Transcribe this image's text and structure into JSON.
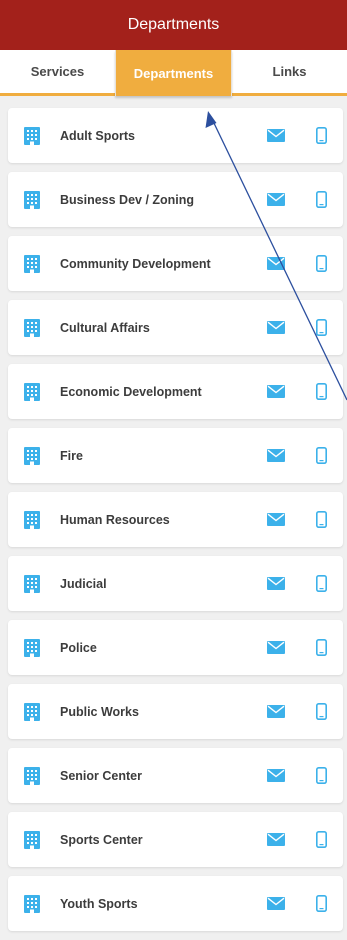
{
  "header": {
    "title": "Departments"
  },
  "tabs": [
    {
      "label": "Services",
      "active": false
    },
    {
      "label": "Departments",
      "active": true
    },
    {
      "label": "Links",
      "active": false
    }
  ],
  "departments": [
    {
      "name": "Adult Sports"
    },
    {
      "name": "Business Dev / Zoning"
    },
    {
      "name": "Community Development"
    },
    {
      "name": "Cultural Affairs"
    },
    {
      "name": "Economic Development"
    },
    {
      "name": "Fire"
    },
    {
      "name": "Human Resources"
    },
    {
      "name": "Judicial"
    },
    {
      "name": "Police"
    },
    {
      "name": "Public Works"
    },
    {
      "name": "Senior Center"
    },
    {
      "name": "Sports Center"
    },
    {
      "name": "Youth Sports"
    }
  ],
  "icons": {
    "department": "building-icon",
    "email": "envelope-icon",
    "phone": "mobile-phone-icon"
  },
  "colors": {
    "header_bg": "#a3211b",
    "tab_active": "#f0ad3f",
    "icon_blue": "#3cb1ea",
    "annotation_arrow": "#2c4f9e"
  }
}
